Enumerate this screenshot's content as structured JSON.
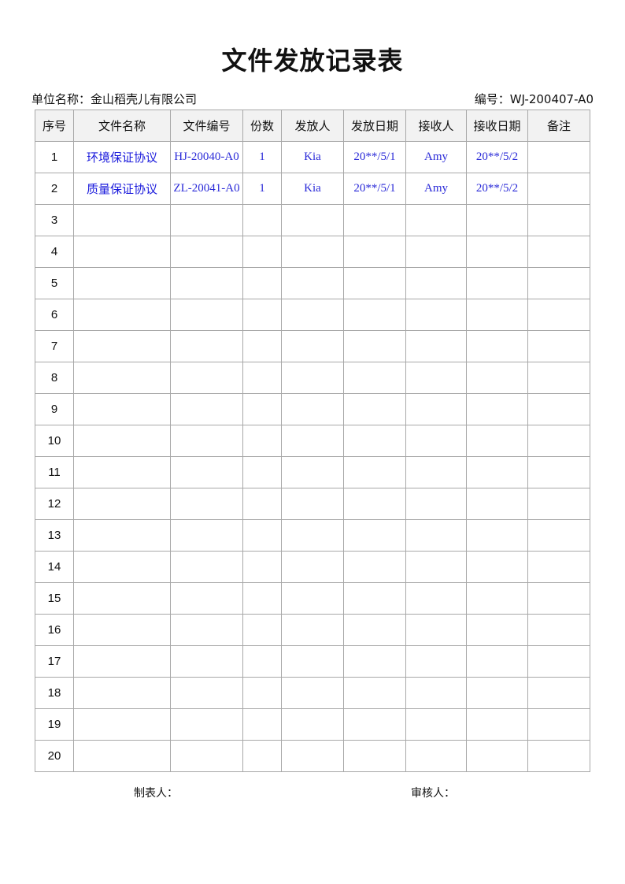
{
  "title": "文件发放记录表",
  "unit_label": "单位名称：金山稻壳儿有限公司",
  "code_label": "编号：WJ-200407-A0",
  "columns": [
    "序号",
    "文件名称",
    "文件编号",
    "份数",
    "发放人",
    "发放日期",
    "接收人",
    "接收日期",
    "备注"
  ],
  "rows": [
    {
      "seq": "1",
      "name": "环境保证协议",
      "code": "HJ-20040-A0",
      "copies": "1",
      "issuer": "Kia",
      "issue_date": "20**/5/1",
      "receiver": "Amy",
      "receive_date": "20**/5/2",
      "note": ""
    },
    {
      "seq": "2",
      "name": "质量保证协议",
      "code": "ZL-20041-A0",
      "copies": "1",
      "issuer": "Kia",
      "issue_date": "20**/5/1",
      "receiver": "Amy",
      "receive_date": "20**/5/2",
      "note": ""
    },
    {
      "seq": "3",
      "name": "",
      "code": "",
      "copies": "",
      "issuer": "",
      "issue_date": "",
      "receiver": "",
      "receive_date": "",
      "note": ""
    },
    {
      "seq": "4",
      "name": "",
      "code": "",
      "copies": "",
      "issuer": "",
      "issue_date": "",
      "receiver": "",
      "receive_date": "",
      "note": ""
    },
    {
      "seq": "5",
      "name": "",
      "code": "",
      "copies": "",
      "issuer": "",
      "issue_date": "",
      "receiver": "",
      "receive_date": "",
      "note": ""
    },
    {
      "seq": "6",
      "name": "",
      "code": "",
      "copies": "",
      "issuer": "",
      "issue_date": "",
      "receiver": "",
      "receive_date": "",
      "note": ""
    },
    {
      "seq": "7",
      "name": "",
      "code": "",
      "copies": "",
      "issuer": "",
      "issue_date": "",
      "receiver": "",
      "receive_date": "",
      "note": ""
    },
    {
      "seq": "8",
      "name": "",
      "code": "",
      "copies": "",
      "issuer": "",
      "issue_date": "",
      "receiver": "",
      "receive_date": "",
      "note": ""
    },
    {
      "seq": "9",
      "name": "",
      "code": "",
      "copies": "",
      "issuer": "",
      "issue_date": "",
      "receiver": "",
      "receive_date": "",
      "note": ""
    },
    {
      "seq": "10",
      "name": "",
      "code": "",
      "copies": "",
      "issuer": "",
      "issue_date": "",
      "receiver": "",
      "receive_date": "",
      "note": ""
    },
    {
      "seq": "11",
      "name": "",
      "code": "",
      "copies": "",
      "issuer": "",
      "issue_date": "",
      "receiver": "",
      "receive_date": "",
      "note": ""
    },
    {
      "seq": "12",
      "name": "",
      "code": "",
      "copies": "",
      "issuer": "",
      "issue_date": "",
      "receiver": "",
      "receive_date": "",
      "note": ""
    },
    {
      "seq": "13",
      "name": "",
      "code": "",
      "copies": "",
      "issuer": "",
      "issue_date": "",
      "receiver": "",
      "receive_date": "",
      "note": ""
    },
    {
      "seq": "14",
      "name": "",
      "code": "",
      "copies": "",
      "issuer": "",
      "issue_date": "",
      "receiver": "",
      "receive_date": "",
      "note": ""
    },
    {
      "seq": "15",
      "name": "",
      "code": "",
      "copies": "",
      "issuer": "",
      "issue_date": "",
      "receiver": "",
      "receive_date": "",
      "note": ""
    },
    {
      "seq": "16",
      "name": "",
      "code": "",
      "copies": "",
      "issuer": "",
      "issue_date": "",
      "receiver": "",
      "receive_date": "",
      "note": ""
    },
    {
      "seq": "17",
      "name": "",
      "code": "",
      "copies": "",
      "issuer": "",
      "issue_date": "",
      "receiver": "",
      "receive_date": "",
      "note": ""
    },
    {
      "seq": "18",
      "name": "",
      "code": "",
      "copies": "",
      "issuer": "",
      "issue_date": "",
      "receiver": "",
      "receive_date": "",
      "note": ""
    },
    {
      "seq": "19",
      "name": "",
      "code": "",
      "copies": "",
      "issuer": "",
      "issue_date": "",
      "receiver": "",
      "receive_date": "",
      "note": ""
    },
    {
      "seq": "20",
      "name": "",
      "code": "",
      "copies": "",
      "issuer": "",
      "issue_date": "",
      "receiver": "",
      "receive_date": "",
      "note": ""
    }
  ],
  "footer": {
    "maker_label": "制表人：",
    "reviewer_label": "审核人："
  },
  "colors": {
    "filled_text": "#1a1adc",
    "header_bg": "#f2f2f2",
    "grid_line": "#a8a8a8"
  }
}
